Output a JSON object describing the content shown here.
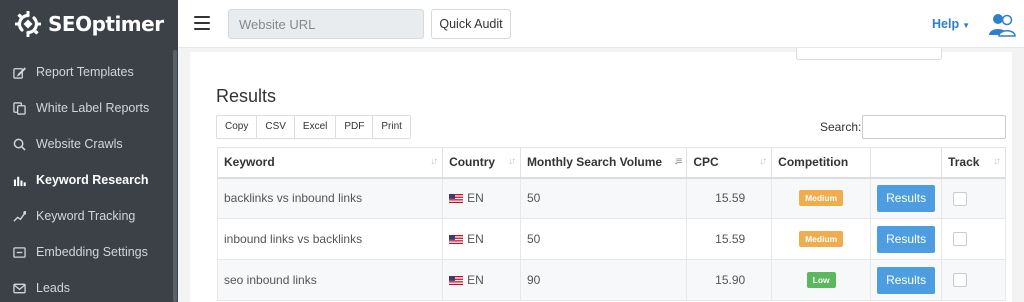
{
  "brand": {
    "name": "SEOptimer",
    "accent": "#2e7fd1",
    "sidebar_bg": "#3b4146"
  },
  "sidebar": {
    "items": [
      {
        "label": "Report Templates",
        "icon": "edit-icon",
        "active": false
      },
      {
        "label": "White Label Reports",
        "icon": "copy-icon",
        "active": false
      },
      {
        "label": "Website Crawls",
        "icon": "search-icon",
        "active": false
      },
      {
        "label": "Keyword Research",
        "icon": "bar-chart-icon",
        "active": true
      },
      {
        "label": "Keyword Tracking",
        "icon": "line-trend-icon",
        "active": false
      },
      {
        "label": "Embedding Settings",
        "icon": "embed-icon",
        "active": false
      },
      {
        "label": "Leads",
        "icon": "envelope-icon",
        "active": false
      }
    ]
  },
  "topbar": {
    "url_placeholder": "Website URL",
    "quick_audit_label": "Quick Audit",
    "help_label": "Help"
  },
  "main": {
    "title": "Results",
    "export_buttons": [
      "Copy",
      "CSV",
      "Excel",
      "PDF",
      "Print"
    ],
    "search_label": "Search:",
    "table": {
      "headers": [
        "Keyword",
        "Country",
        "Monthly Search Volume",
        "CPC",
        "Competition",
        "",
        "Track"
      ],
      "rows": [
        {
          "keyword": "backlinks vs inbound links",
          "country": "EN",
          "volume": "50",
          "cpc": "15.59",
          "competition": "Medium",
          "action": "Results"
        },
        {
          "keyword": "inbound links vs backlinks",
          "country": "EN",
          "volume": "50",
          "cpc": "15.59",
          "competition": "Medium",
          "action": "Results"
        },
        {
          "keyword": "seo inbound links",
          "country": "EN",
          "volume": "90",
          "cpc": "15.90",
          "competition": "Low",
          "action": "Results"
        }
      ]
    }
  }
}
